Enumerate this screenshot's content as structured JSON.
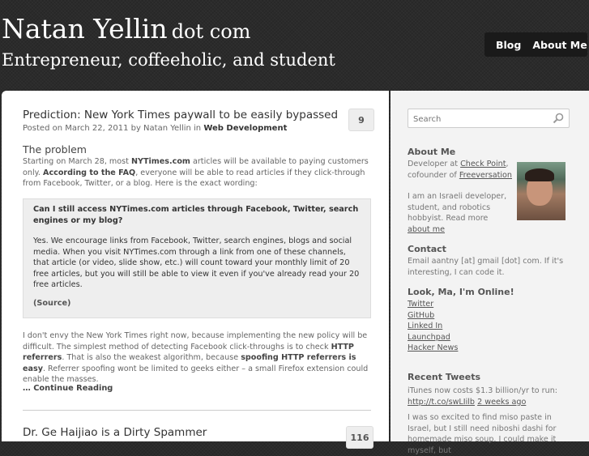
{
  "header": {
    "site_name": "Natan Yellin",
    "site_suffix": "dot com",
    "tagline": "Entrepreneur, coffeeholic, and student",
    "nav": [
      "Blog",
      "About Me"
    ]
  },
  "posts": [
    {
      "title": "Prediction: New York Times paywall to be easily bypassed",
      "comments": "9",
      "meta_prefix": "Posted on March 22, 2011 by Natan Yellin in",
      "category": "Web Development",
      "section_heading": "The problem",
      "intro_1": "Starting on March 28, most",
      "intro_link": "NYTimes.com",
      "intro_2": "articles will be available to paying customers only.",
      "faq_link": "According to the FAQ",
      "intro_3": ", everyone will be able to read articles if they click-through from Facebook, Twitter, or a blog. Here is the exact wording:",
      "quote_question": "Can I still access NYTimes.com articles through Facebook, Twitter, search engines or my blog?",
      "quote_answer": "Yes. We encourage links from Facebook, Twitter, search engines, blogs and social media. When you visit NYTimes.com through a link from one of these channels, that article (or video, slide show, etc.) will count toward your monthly limit of 20 free articles, but you will still be able to view it even if you've already read your 20 free articles.",
      "quote_source": "(Source)",
      "body_1": "I don't envy the New York Times right now, because implementing the new policy will be difficult. The simplest method of detecting Facebook click-throughs is to check",
      "body_b1": "HTTP referrers",
      "body_2": ". That is also the weakest algorithm, because",
      "body_b2": "spoofing HTTP referrers is easy",
      "body_3": ". Referrer spoofing wont be limited to geeks either – a small Firefox extension could enable the masses.",
      "continue": "… Continue Reading"
    },
    {
      "title": "Dr. Ge Haijiao is a Dirty Spammer",
      "comments": "116"
    }
  ],
  "sidebar": {
    "search_placeholder": "Search",
    "about_heading": "About Me",
    "about_1": "Developer at",
    "about_link1": "Check Point",
    "about_2": "cofounder of",
    "about_link2": "Freeversation",
    "about_3": "I am an Israeli developer, student, and robotics hobbyist. Read more",
    "about_link3": "about me",
    "contact_heading": "Contact",
    "contact_text": "Email aantny [at] gmail [dot] com. If it's interesting, I can code it.",
    "online_heading": "Look, Ma, I'm Online!",
    "online_links": [
      "Twitter",
      "GitHub",
      "Linked In",
      "Launchpad",
      "Hacker News"
    ],
    "tweets_heading": "Recent Tweets",
    "tweet1_text": "iTunes now costs $1.3 billion/yr to run:",
    "tweet1_link": "http://t.co/swLIilb",
    "tweet1_time": "2 weeks ago",
    "tweet2_text": "I was so excited to find miso paste in Israel, but I still need niboshi dashi for homemade miso soup. I could make it myself, but"
  }
}
